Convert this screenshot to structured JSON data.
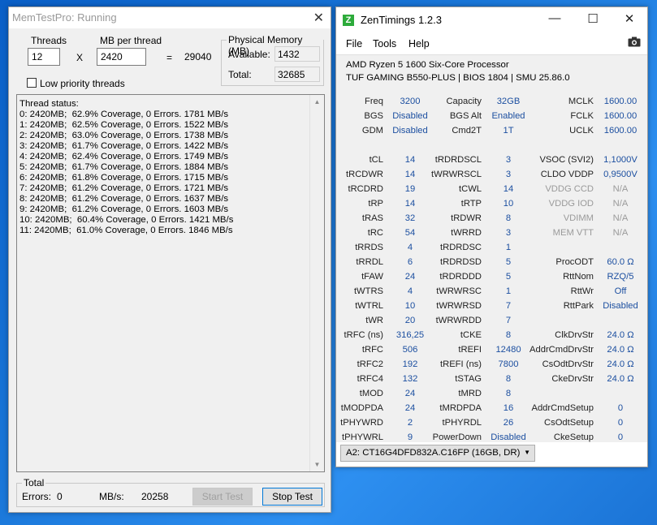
{
  "memtest": {
    "title": "MemTestPro: Running",
    "threads_label": "Threads",
    "threads_value": "12",
    "times": "X",
    "mb_label": "MB per thread",
    "mb_value": "2420",
    "equals": "=",
    "total_mb": "29040",
    "physical_label": "Physical Memory (MB)",
    "available_label": "Available:",
    "available_value": "1432",
    "total_label": "Total:",
    "total_value": "32685",
    "low_priority_label": "Low priority threads",
    "status_lines": [
      "Thread status:",
      "0: 2420MB;  62.9% Coverage, 0 Errors. 1781 MB/s",
      "1: 2420MB;  62.5% Coverage, 0 Errors. 1522 MB/s",
      "2: 2420MB;  63.0% Coverage, 0 Errors. 1738 MB/s",
      "3: 2420MB;  61.7% Coverage, 0 Errors. 1422 MB/s",
      "4: 2420MB;  62.4% Coverage, 0 Errors. 1749 MB/s",
      "5: 2420MB;  61.7% Coverage, 0 Errors. 1884 MB/s",
      "6: 2420MB;  61.8% Coverage, 0 Errors. 1715 MB/s",
      "7: 2420MB;  61.2% Coverage, 0 Errors. 1721 MB/s",
      "8: 2420MB;  61.2% Coverage, 0 Errors. 1637 MB/s",
      "9: 2420MB;  61.2% Coverage, 0 Errors. 1603 MB/s",
      "10: 2420MB;  60.4% Coverage, 0 Errors. 1421 MB/s",
      "11: 2420MB;  61.0% Coverage, 0 Errors. 1846 MB/s"
    ],
    "total_group_label": "Total",
    "errors_label": "Errors:",
    "errors_value": "0",
    "mbs_label": "MB/s:",
    "mbs_value": "20258",
    "start_label": "Start Test",
    "stop_label": "Stop Test"
  },
  "zen": {
    "title": "ZenTimings 1.2.3",
    "logo": "Z",
    "menu": [
      "File",
      "Tools",
      "Help"
    ],
    "cpu": "AMD Ryzen 5 1600 Six-Core Processor",
    "board": "TUF GAMING B550-PLUS | BIOS 1804 | SMU 25.86.0",
    "col1": [
      {
        "l": "Freq",
        "v": "3200"
      },
      {
        "l": "BGS",
        "v": "Disabled"
      },
      {
        "l": "GDM",
        "v": "Disabled"
      },
      null,
      {
        "l": "tCL",
        "v": "14"
      },
      {
        "l": "tRCDWR",
        "v": "14"
      },
      {
        "l": "tRCDRD",
        "v": "19"
      },
      {
        "l": "tRP",
        "v": "14"
      },
      {
        "l": "tRAS",
        "v": "32"
      },
      {
        "l": "tRC",
        "v": "54"
      },
      {
        "l": "tRRDS",
        "v": "4"
      },
      {
        "l": "tRRDL",
        "v": "6"
      },
      {
        "l": "tFAW",
        "v": "24"
      },
      {
        "l": "tWTRS",
        "v": "4"
      },
      {
        "l": "tWTRL",
        "v": "10"
      },
      {
        "l": "tWR",
        "v": "20"
      },
      {
        "l": "tRFC (ns)",
        "v": "316,25"
      },
      {
        "l": "tRFC",
        "v": "506"
      },
      {
        "l": "tRFC2",
        "v": "192"
      },
      {
        "l": "tRFC4",
        "v": "132"
      },
      {
        "l": "tMOD",
        "v": "24"
      },
      {
        "l": "tMODPDA",
        "v": "24"
      },
      {
        "l": "tPHYWRD",
        "v": "2"
      },
      {
        "l": "tPHYWRL",
        "v": "9"
      }
    ],
    "col2": [
      {
        "l": "Capacity",
        "v": "32GB"
      },
      {
        "l": "BGS Alt",
        "v": "Enabled"
      },
      {
        "l": "Cmd2T",
        "v": "1T"
      },
      null,
      {
        "l": "tRDRDSCL",
        "v": "3"
      },
      {
        "l": "tWRWRSCL",
        "v": "3"
      },
      {
        "l": "tCWL",
        "v": "14"
      },
      {
        "l": "tRTP",
        "v": "10"
      },
      {
        "l": "tRDWR",
        "v": "8"
      },
      {
        "l": "tWRRD",
        "v": "3"
      },
      {
        "l": "tRDRDSC",
        "v": "1"
      },
      {
        "l": "tRDRDSD",
        "v": "5"
      },
      {
        "l": "tRDRDDD",
        "v": "5"
      },
      {
        "l": "tWRWRSC",
        "v": "1"
      },
      {
        "l": "tWRWRSD",
        "v": "7"
      },
      {
        "l": "tWRWRDD",
        "v": "7"
      },
      {
        "l": "tCKE",
        "v": "8"
      },
      {
        "l": "tREFI",
        "v": "12480"
      },
      {
        "l": "tREFI (ns)",
        "v": "7800"
      },
      {
        "l": "tSTAG",
        "v": "8"
      },
      {
        "l": "tMRD",
        "v": "8"
      },
      {
        "l": "tMRDPDA",
        "v": "16"
      },
      {
        "l": "tPHYRDL",
        "v": "26"
      },
      {
        "l": "PowerDown",
        "v": "Disabled"
      }
    ],
    "col3": [
      {
        "l": "MCLK",
        "v": "1600.00"
      },
      {
        "l": "FCLK",
        "v": "1600.00"
      },
      {
        "l": "UCLK",
        "v": "1600.00"
      },
      null,
      {
        "l": "VSOC (SVI2)",
        "v": "1,1000V"
      },
      {
        "l": "CLDO VDDP",
        "v": "0,9500V"
      },
      {
        "l": "VDDG CCD",
        "v": "N/A",
        "grey": true
      },
      {
        "l": "VDDG IOD",
        "v": "N/A",
        "grey": true
      },
      {
        "l": "VDIMM",
        "v": "N/A",
        "grey": true
      },
      {
        "l": "MEM VTT",
        "v": "N/A",
        "grey": true
      },
      null,
      {
        "l": "ProcODT",
        "v": "60.0 Ω"
      },
      {
        "l": "RttNom",
        "v": "RZQ/5"
      },
      {
        "l": "RttWr",
        "v": "Off"
      },
      {
        "l": "RttPark",
        "v": "Disabled"
      },
      null,
      {
        "l": "ClkDrvStr",
        "v": "24.0 Ω"
      },
      {
        "l": "AddrCmdDrvStr",
        "v": "24.0 Ω"
      },
      {
        "l": "CsOdtDrvStr",
        "v": "24.0 Ω"
      },
      {
        "l": "CkeDrvStr",
        "v": "24.0 Ω"
      },
      null,
      {
        "l": "AddrCmdSetup",
        "v": "0"
      },
      {
        "l": "CsOdtSetup",
        "v": "0"
      },
      {
        "l": "CkeSetup",
        "v": "0"
      }
    ],
    "module": "A2: CT16G4DFD832A.C16FP (16GB, DR)"
  },
  "colors": {
    "value_blue": "#1c4fa0",
    "disabled_grey": "#9a9a9a",
    "desktop_blue": "#1976d8",
    "logo_green": "#2dab3b"
  },
  "icons": {
    "close": "close-icon",
    "minimize": "minimize-icon",
    "maximize": "maximize-icon",
    "camera": "camera-icon",
    "dropdown": "chevron-down-icon"
  }
}
